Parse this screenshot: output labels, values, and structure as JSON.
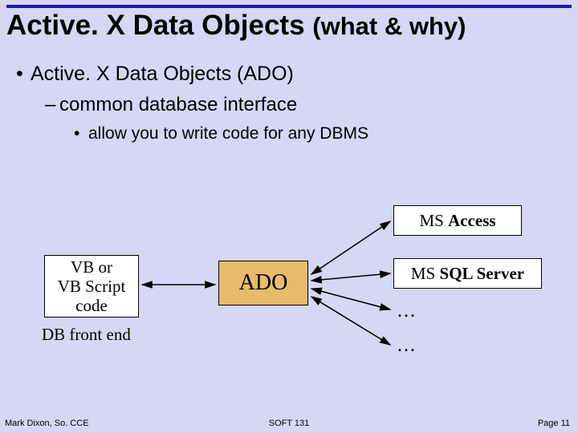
{
  "title": {
    "main": "Active. X Data Objects",
    "paren": "(what & why)"
  },
  "bullets": {
    "level1": "Active. X Data Objects (ADO)",
    "level2": "common database interface",
    "level3": "allow you to write code for any DBMS"
  },
  "diagram": {
    "left_box_line1": "VB or",
    "left_box_line2": "VB Script",
    "left_box_line3": "code",
    "left_caption": "DB front end",
    "center_box": "ADO",
    "right_box_normal": "MS ",
    "right_box_1_bold": "Access",
    "right_box_2_bold": "SQL Server",
    "ellipsis": "…"
  },
  "footer": {
    "left": "Mark Dixon, So. CCE",
    "center": "SOFT 131",
    "right": "Page 11"
  }
}
